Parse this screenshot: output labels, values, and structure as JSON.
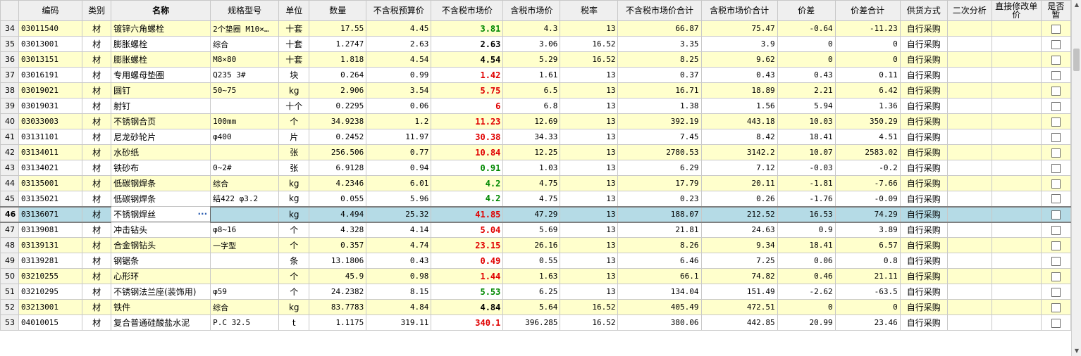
{
  "columns": [
    "",
    "编码",
    "类别",
    "名称",
    "规格型号",
    "单位",
    "数量",
    "不含税预算价",
    "不含税市场价",
    "含税市场价",
    "税率",
    "不含税市场价合计",
    "含税市场价合计",
    "价差",
    "价差合计",
    "供货方式",
    "二次分析",
    "直接修改单价",
    "是否暂"
  ],
  "rows": [
    {
      "n": "34",
      "code": "03011540",
      "cat": "材",
      "name": "镀锌六角螺栓",
      "spec": "2个垫圈 M10×…",
      "unit": "十套",
      "qty": "17.55",
      "budget": "4.45",
      "market": "3.81",
      "mcolor": "green",
      "taxmarket": "4.3",
      "rate": "13",
      "totalex": "66.87",
      "totalinc": "75.47",
      "diff": "-0.64",
      "difftotal": "-11.23",
      "supply": "自行采购"
    },
    {
      "n": "35",
      "code": "03013001",
      "cat": "材",
      "name": "膨胀螺栓",
      "spec": "综合",
      "unit": "十套",
      "qty": "1.2747",
      "budget": "2.63",
      "market": "2.63",
      "mcolor": "black",
      "taxmarket": "3.06",
      "rate": "16.52",
      "totalex": "3.35",
      "totalinc": "3.9",
      "diff": "0",
      "difftotal": "0",
      "supply": "自行采购"
    },
    {
      "n": "36",
      "code": "03013151",
      "cat": "材",
      "name": "膨胀螺栓",
      "spec": "M8×80",
      "unit": "十套",
      "qty": "1.818",
      "budget": "4.54",
      "market": "4.54",
      "mcolor": "black",
      "taxmarket": "5.29",
      "rate": "16.52",
      "totalex": "8.25",
      "totalinc": "9.62",
      "diff": "0",
      "difftotal": "0",
      "supply": "自行采购"
    },
    {
      "n": "37",
      "code": "03016191",
      "cat": "材",
      "name": "专用螺母垫圈",
      "spec": "Q235 3#",
      "unit": "块",
      "qty": "0.264",
      "budget": "0.99",
      "market": "1.42",
      "mcolor": "red",
      "taxmarket": "1.61",
      "rate": "13",
      "totalex": "0.37",
      "totalinc": "0.43",
      "diff": "0.43",
      "difftotal": "0.11",
      "supply": "自行采购"
    },
    {
      "n": "38",
      "code": "03019021",
      "cat": "材",
      "name": "圆钉",
      "spec": "50~75",
      "unit": "kg",
      "qty": "2.906",
      "budget": "3.54",
      "market": "5.75",
      "mcolor": "red",
      "taxmarket": "6.5",
      "rate": "13",
      "totalex": "16.71",
      "totalinc": "18.89",
      "diff": "2.21",
      "difftotal": "6.42",
      "supply": "自行采购"
    },
    {
      "n": "39",
      "code": "03019031",
      "cat": "材",
      "name": "射钉",
      "spec": "",
      "unit": "十个",
      "qty": "0.2295",
      "budget": "0.06",
      "market": "6",
      "mcolor": "red",
      "taxmarket": "6.8",
      "rate": "13",
      "totalex": "1.38",
      "totalinc": "1.56",
      "diff": "5.94",
      "difftotal": "1.36",
      "supply": "自行采购"
    },
    {
      "n": "40",
      "code": "03033003",
      "cat": "材",
      "name": "不锈钢合页",
      "spec": "100mm",
      "unit": "个",
      "qty": "34.9238",
      "budget": "1.2",
      "market": "11.23",
      "mcolor": "red",
      "taxmarket": "12.69",
      "rate": "13",
      "totalex": "392.19",
      "totalinc": "443.18",
      "diff": "10.03",
      "difftotal": "350.29",
      "supply": "自行采购"
    },
    {
      "n": "41",
      "code": "03131101",
      "cat": "材",
      "name": "尼龙砂轮片",
      "spec": "φ400",
      "unit": "片",
      "qty": "0.2452",
      "budget": "11.97",
      "market": "30.38",
      "mcolor": "red",
      "taxmarket": "34.33",
      "rate": "13",
      "totalex": "7.45",
      "totalinc": "8.42",
      "diff": "18.41",
      "difftotal": "4.51",
      "supply": "自行采购"
    },
    {
      "n": "42",
      "code": "03134011",
      "cat": "材",
      "name": "水砂纸",
      "spec": "",
      "unit": "张",
      "qty": "256.506",
      "budget": "0.77",
      "market": "10.84",
      "mcolor": "red",
      "taxmarket": "12.25",
      "rate": "13",
      "totalex": "2780.53",
      "totalinc": "3142.2",
      "diff": "10.07",
      "difftotal": "2583.02",
      "supply": "自行采购"
    },
    {
      "n": "43",
      "code": "03134021",
      "cat": "材",
      "name": "铁砂布",
      "spec": "0~2#",
      "unit": "张",
      "qty": "6.9128",
      "budget": "0.94",
      "market": "0.91",
      "mcolor": "green",
      "taxmarket": "1.03",
      "rate": "13",
      "totalex": "6.29",
      "totalinc": "7.12",
      "diff": "-0.03",
      "difftotal": "-0.2",
      "supply": "自行采购"
    },
    {
      "n": "44",
      "code": "03135001",
      "cat": "材",
      "name": "低碳钢焊条",
      "spec": "综合",
      "unit": "kg",
      "qty": "4.2346",
      "budget": "6.01",
      "market": "4.2",
      "mcolor": "green",
      "taxmarket": "4.75",
      "rate": "13",
      "totalex": "17.79",
      "totalinc": "20.11",
      "diff": "-1.81",
      "difftotal": "-7.66",
      "supply": "自行采购"
    },
    {
      "n": "45",
      "code": "03135021",
      "cat": "材",
      "name": "低碳钢焊条",
      "spec": "结422 φ3.2",
      "unit": "kg",
      "qty": "0.055",
      "budget": "5.96",
      "market": "4.2",
      "mcolor": "green",
      "taxmarket": "4.75",
      "rate": "13",
      "totalex": "0.23",
      "totalinc": "0.26",
      "diff": "-1.76",
      "difftotal": "-0.09",
      "supply": "自行采购"
    },
    {
      "n": "46",
      "code": "03136071",
      "cat": "材",
      "name": "不锈钢焊丝",
      "spec": "",
      "unit": "kg",
      "qty": "4.494",
      "budget": "25.32",
      "market": "41.85",
      "mcolor": "red",
      "taxmarket": "47.29",
      "rate": "13",
      "totalex": "188.07",
      "totalinc": "212.52",
      "diff": "16.53",
      "difftotal": "74.29",
      "supply": "自行采购",
      "selected": true
    },
    {
      "n": "47",
      "code": "03139081",
      "cat": "材",
      "name": "冲击钻头",
      "spec": "φ8~16",
      "unit": "个",
      "qty": "4.328",
      "budget": "4.14",
      "market": "5.04",
      "mcolor": "red",
      "taxmarket": "5.69",
      "rate": "13",
      "totalex": "21.81",
      "totalinc": "24.63",
      "diff": "0.9",
      "difftotal": "3.89",
      "supply": "自行采购"
    },
    {
      "n": "48",
      "code": "03139131",
      "cat": "材",
      "name": "合金钢钻头",
      "spec": "一字型",
      "unit": "个",
      "qty": "0.357",
      "budget": "4.74",
      "market": "23.15",
      "mcolor": "red",
      "taxmarket": "26.16",
      "rate": "13",
      "totalex": "8.26",
      "totalinc": "9.34",
      "diff": "18.41",
      "difftotal": "6.57",
      "supply": "自行采购"
    },
    {
      "n": "49",
      "code": "03139281",
      "cat": "材",
      "name": "钢锯条",
      "spec": "",
      "unit": "条",
      "qty": "13.1806",
      "budget": "0.43",
      "market": "0.49",
      "mcolor": "red",
      "taxmarket": "0.55",
      "rate": "13",
      "totalex": "6.46",
      "totalinc": "7.25",
      "diff": "0.06",
      "difftotal": "0.8",
      "supply": "自行采购"
    },
    {
      "n": "50",
      "code": "03210255",
      "cat": "材",
      "name": "心形环",
      "spec": "",
      "unit": "个",
      "qty": "45.9",
      "budget": "0.98",
      "market": "1.44",
      "mcolor": "red",
      "taxmarket": "1.63",
      "rate": "13",
      "totalex": "66.1",
      "totalinc": "74.82",
      "diff": "0.46",
      "difftotal": "21.11",
      "supply": "自行采购"
    },
    {
      "n": "51",
      "code": "03210295",
      "cat": "材",
      "name": "不锈钢法兰座(装饰用)",
      "spec": "φ59",
      "unit": "个",
      "qty": "24.2382",
      "budget": "8.15",
      "market": "5.53",
      "mcolor": "green",
      "taxmarket": "6.25",
      "rate": "13",
      "totalex": "134.04",
      "totalinc": "151.49",
      "diff": "-2.62",
      "difftotal": "-63.5",
      "supply": "自行采购"
    },
    {
      "n": "52",
      "code": "03213001",
      "cat": "材",
      "name": "铁件",
      "spec": "综合",
      "unit": "kg",
      "qty": "83.7783",
      "budget": "4.84",
      "market": "4.84",
      "mcolor": "black",
      "taxmarket": "5.64",
      "rate": "16.52",
      "totalex": "405.49",
      "totalinc": "472.51",
      "diff": "0",
      "difftotal": "0",
      "supply": "自行采购"
    },
    {
      "n": "53",
      "code": "04010015",
      "cat": "材",
      "name": "复合普通硅酸盐水泥",
      "spec": "P.C 32.5",
      "unit": "t",
      "qty": "1.1175",
      "budget": "319.11",
      "market": "340.1",
      "mcolor": "red",
      "taxmarket": "396.285",
      "rate": "16.52",
      "totalex": "380.06",
      "totalinc": "442.85",
      "diff": "20.99",
      "difftotal": "23.46",
      "supply": "自行采购"
    }
  ],
  "editing_cell": {
    "row": "46",
    "column": "名称",
    "button_label": "···"
  },
  "colors": {
    "odd_row": "#ffffcc",
    "selected_row": "#b5dbe6",
    "red": "#e00000",
    "green": "#008800",
    "header": "#efefef"
  },
  "icons": {
    "scroll_up": "triangle-up",
    "scroll_down": "triangle-down"
  }
}
